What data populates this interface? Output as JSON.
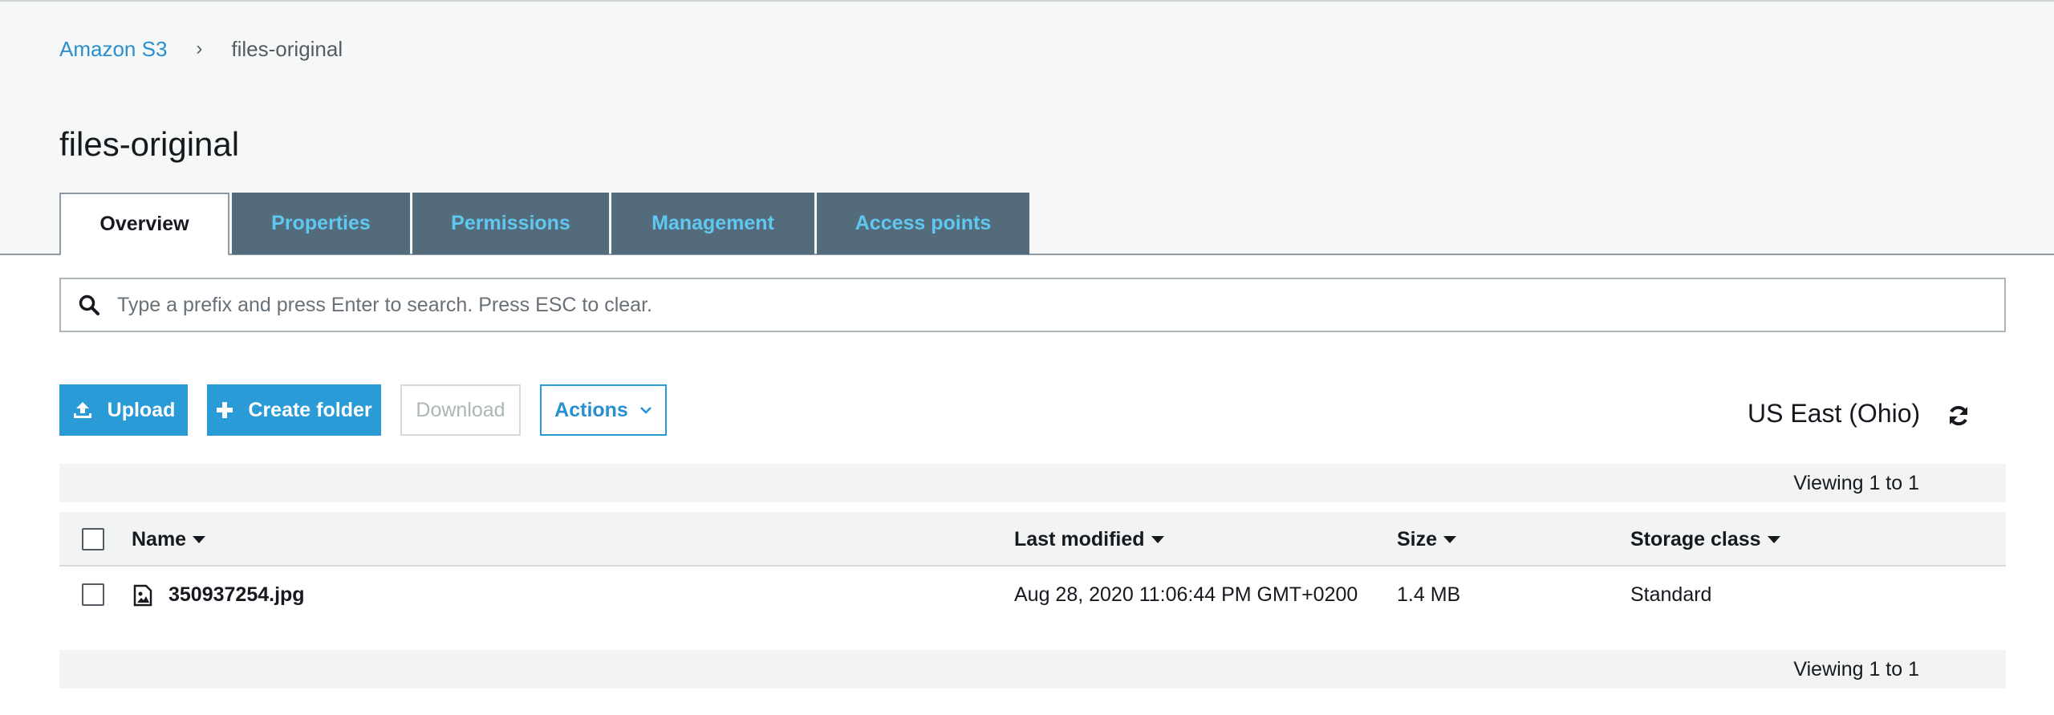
{
  "breadcrumb": {
    "root": "Amazon S3",
    "separator": "›",
    "current": "files-original"
  },
  "page": {
    "title": "files-original"
  },
  "tabs": [
    {
      "label": "Overview",
      "active": true
    },
    {
      "label": "Properties",
      "active": false
    },
    {
      "label": "Permissions",
      "active": false
    },
    {
      "label": "Management",
      "active": false
    },
    {
      "label": "Access points",
      "active": false
    }
  ],
  "search": {
    "placeholder": "Type a prefix and press Enter to search. Press ESC to clear.",
    "icon": "search-icon"
  },
  "toolbar": {
    "upload_label": "Upload",
    "create_folder_label": "Create folder",
    "download_label": "Download",
    "actions_label": "Actions"
  },
  "region": {
    "label": "US East (Ohio)"
  },
  "viewing": {
    "top": "Viewing 1 to 1",
    "bottom": "Viewing 1 to 1"
  },
  "table": {
    "columns": {
      "name": "Name",
      "last_modified": "Last modified",
      "size": "Size",
      "storage_class": "Storage class"
    },
    "rows": [
      {
        "name": "350937254.jpg",
        "last_modified": "Aug 28, 2020 11:06:44 PM GMT+0200",
        "size": "1.4 MB",
        "storage_class": "Standard",
        "icon": "image-file-icon"
      }
    ]
  },
  "colors": {
    "accent": "#2a9bd6",
    "link": "#2a8fce",
    "tab_bg": "#546b7c",
    "tab_text": "#5ec8f1"
  }
}
